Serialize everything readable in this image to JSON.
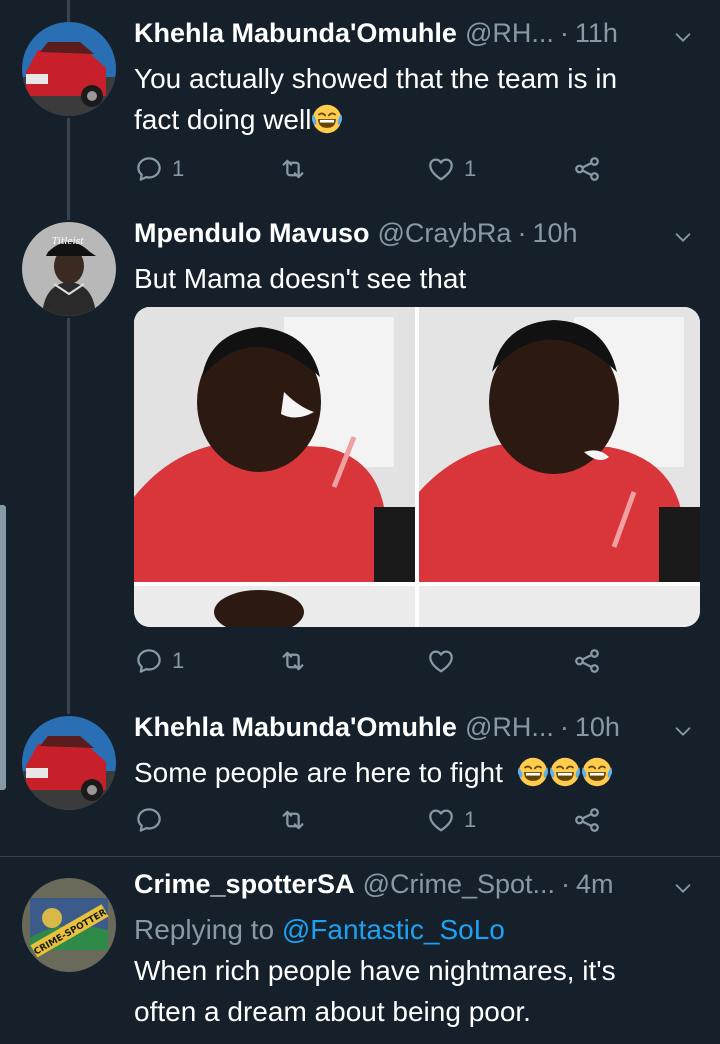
{
  "tweets": [
    {
      "name": "Khehla Mabunda'Omuhle",
      "handle": "@RH...",
      "time": "11h",
      "text_lines": [
        "You actually showed that the team is in",
        "fact doing well"
      ],
      "emoji": "face-with-tears-of-joy",
      "reply_count": "1",
      "retweet_count": "",
      "like_count": "1",
      "avatar": "red-car-avatar"
    },
    {
      "name": "Mpendulo Mavuso",
      "handle": "@CraybRa",
      "time": "10h",
      "text": "But Mama doesn't see that",
      "media": "boy-laughing-crying-meme",
      "reply_count": "1",
      "retweet_count": "",
      "like_count": "",
      "avatar": "man-in-cap-avatar",
      "avatar_cap_text": "Titleist"
    },
    {
      "name": "Khehla Mabunda'Omuhle",
      "handle": "@RH...",
      "time": "10h",
      "text": "Some people are here to fight",
      "emoji_count": 3,
      "reply_count": "",
      "retweet_count": "",
      "like_count": "1",
      "avatar": "red-car-avatar"
    },
    {
      "name": "Crime_spotterSA",
      "handle": "@Crime_Spot...",
      "time": "4m",
      "replying_prefix": "Replying to",
      "replying_to": "@Fantastic_SoLo",
      "text_lines": [
        "When rich people have nightmares, it's",
        "often a dream about being poor."
      ],
      "avatar": "crime-spotter-logo-avatar",
      "avatar_text": "CRIME-SPOTTER"
    }
  ],
  "colors": {
    "background": "#15202b",
    "secondary_text": "#8899a6",
    "link": "#1da1f2",
    "divider": "#38444d"
  },
  "icons": [
    "reply-icon",
    "retweet-icon",
    "like-icon",
    "share-icon",
    "chevron-down-icon"
  ]
}
